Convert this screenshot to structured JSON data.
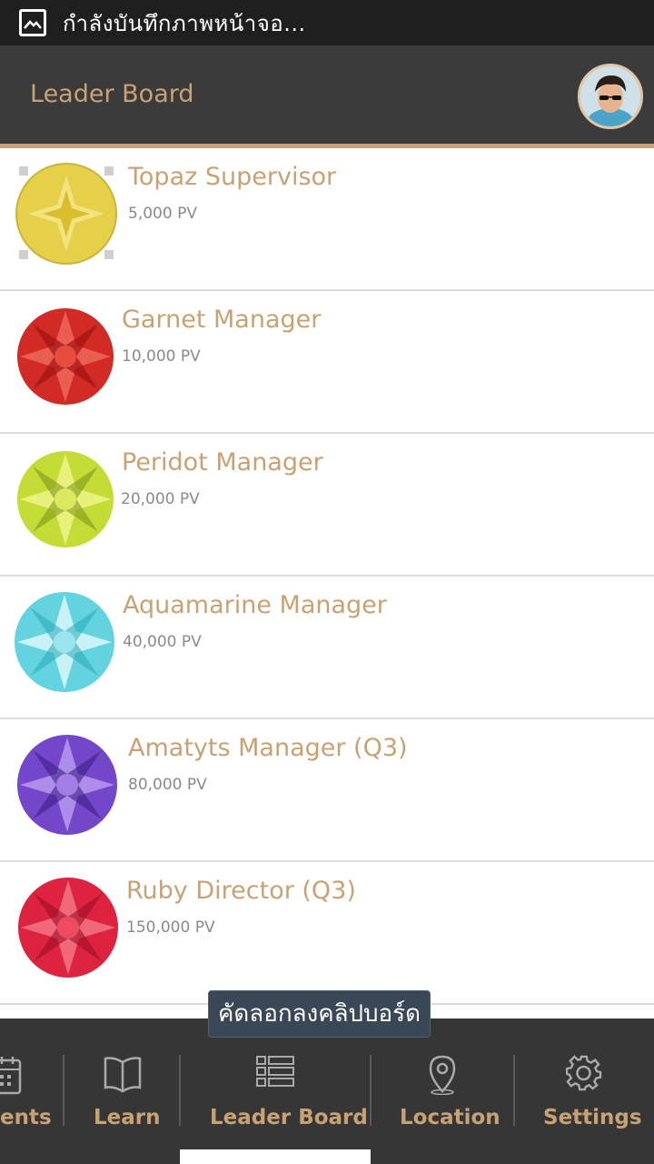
{
  "status_bar": {
    "text": "กำลังบันทึกภาพหน้าจอ..."
  },
  "header": {
    "title": "Leader Board"
  },
  "leaderboard": [
    {
      "name": "Topaz Supervisor",
      "pv": "5,000 PV",
      "gem": "topaz",
      "color": "#e8d34a"
    },
    {
      "name": "Garnet Manager",
      "pv": "10,000 PV",
      "gem": "garnet",
      "color": "#d7282a"
    },
    {
      "name": "Peridot Manager",
      "pv": "20,000 PV",
      "gem": "peridot",
      "color": "#c9e03a"
    },
    {
      "name": "Aquamarine Manager",
      "pv": "40,000 PV",
      "gem": "aquamarine",
      "color": "#5fd3de"
    },
    {
      "name": "Amatyts Manager (Q3)",
      "pv": "80,000 PV",
      "gem": "amethyst",
      "color": "#7b4bd1"
    },
    {
      "name": "Ruby Director (Q3)",
      "pv": "150,000 PV",
      "gem": "ruby",
      "color": "#e0223f"
    }
  ],
  "toast": {
    "text": "คัดลอกลงคลิปบอร์ด"
  },
  "bottom_nav": {
    "items": [
      {
        "label": "ents",
        "icon": "calendar-icon"
      },
      {
        "label": "Learn",
        "icon": "book-icon"
      },
      {
        "label": "Leader Board",
        "icon": "list-icon",
        "active": true
      },
      {
        "label": "Location",
        "icon": "location-pin-icon"
      },
      {
        "label": "Settings",
        "icon": "gear-icon"
      }
    ]
  },
  "colors": {
    "accent": "#c9a273",
    "header_bg": "#3b3b3b",
    "nav_bg": "#363636"
  }
}
